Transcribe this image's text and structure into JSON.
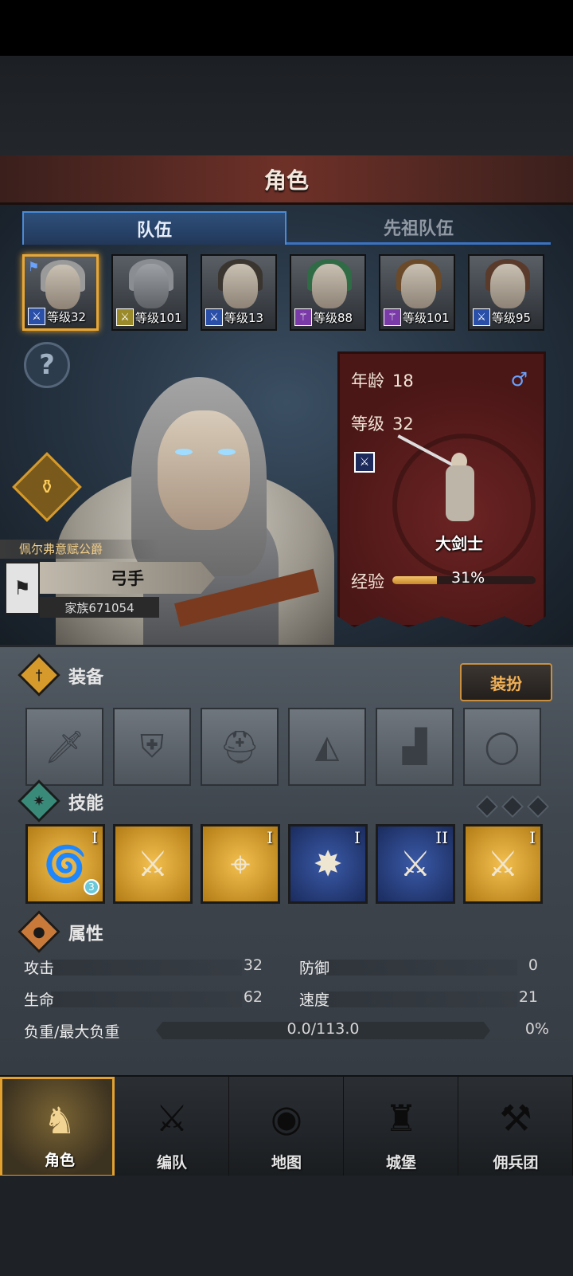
{
  "header": {
    "title": "角色"
  },
  "tabs": [
    {
      "label": "队伍",
      "active": true
    },
    {
      "label": "先祖队伍",
      "active": false
    }
  ],
  "roster": [
    {
      "level": "等级32",
      "class_color": "#2a4fa8",
      "hair": "#9a9a9a",
      "selected": true,
      "flag": "⚑"
    },
    {
      "level": "等级101",
      "class_color": "#9a8a2a",
      "hair": "#8a8d92",
      "selected": false
    },
    {
      "level": "等级13",
      "class_color": "#2a4fa8",
      "hair": "#3b3530",
      "selected": false
    },
    {
      "level": "等级88",
      "class_color": "#7a3aa8",
      "hair": "#2f6b45",
      "selected": false
    },
    {
      "level": "等级101",
      "class_color": "#7a3aa8",
      "hair": "#6b4a2a",
      "selected": false
    },
    {
      "level": "等级95",
      "class_color": "#2a4fa8",
      "hair": "#5a3a2a",
      "selected": false
    }
  ],
  "hero": {
    "title": "佩尔弗意赋公爵",
    "class_label": "弓手",
    "family": "家族671054"
  },
  "info": {
    "age_label": "年龄",
    "age": "18",
    "level_label": "等级",
    "level": "32",
    "gender_icon": "♂",
    "class_name": "大剑士",
    "xp_label": "经验",
    "xp_percent": 31,
    "xp_text": "31%"
  },
  "equipment": {
    "label": "装备",
    "dress_button": "装扮",
    "slots": [
      "sword-slot",
      "shield-slot",
      "helmet-slot",
      "armor-slot",
      "boots-slot",
      "ring-slot"
    ]
  },
  "skills": {
    "label": "技能",
    "items": [
      {
        "style": "gold",
        "rank": "I",
        "badge": "3",
        "icon": "whirlwind-icon"
      },
      {
        "style": "gold",
        "rank": "",
        "badge": "",
        "icon": "sword-aura-icon"
      },
      {
        "style": "gold",
        "rank": "I",
        "badge": "",
        "icon": "target-strike-icon"
      },
      {
        "style": "blue",
        "rank": "I",
        "badge": "",
        "icon": "shield-burst-icon"
      },
      {
        "style": "blue",
        "rank": "II",
        "badge": "",
        "icon": "crossed-swords-icon"
      },
      {
        "style": "gold",
        "rank": "I",
        "badge": "",
        "icon": "crossed-swords-icon"
      }
    ]
  },
  "attributes": {
    "label": "属性",
    "attack_label": "攻击",
    "attack": "32",
    "defense_label": "防御",
    "defense": "0",
    "hp_label": "生命",
    "hp": "62",
    "speed_label": "速度",
    "speed": "21",
    "load_label": "负重/最大负重",
    "load_text": "0.0/113.0",
    "load_percent_text": "0%",
    "load_percent": 0
  },
  "nav": [
    {
      "label": "角色",
      "icon": "knight-icon",
      "active": true
    },
    {
      "label": "编队",
      "icon": "formation-icon",
      "active": false
    },
    {
      "label": "地图",
      "icon": "map-compass-icon",
      "active": false
    },
    {
      "label": "城堡",
      "icon": "castle-icon",
      "active": false
    },
    {
      "label": "佣兵团",
      "icon": "mercenary-icon",
      "active": false
    }
  ],
  "colors": {
    "accent_gold": "#e8a634",
    "tab_blue": "#4a8ad6",
    "card_red": "#6b2323"
  }
}
